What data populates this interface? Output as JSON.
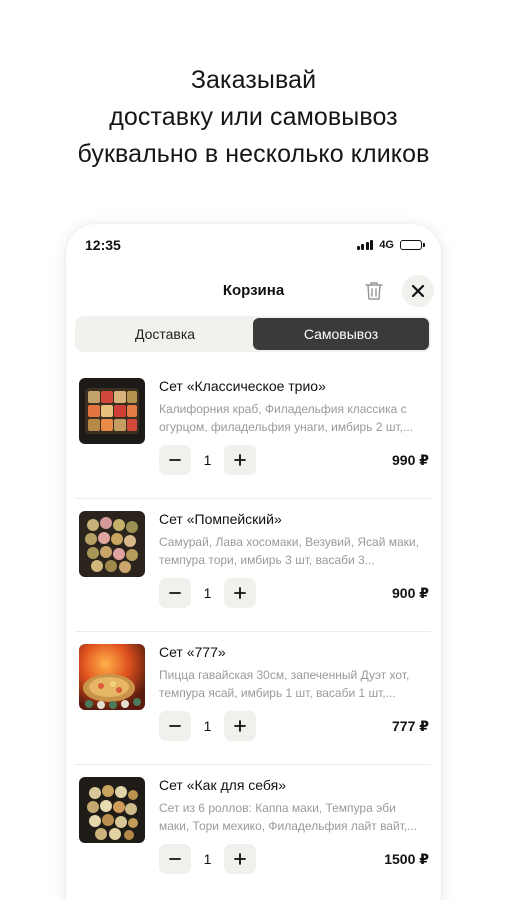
{
  "promo": {
    "line1": "Заказывай",
    "line2": "доставку или самовывоз",
    "line3": "буквально в несколько кликов"
  },
  "status_bar": {
    "time": "12:35",
    "network": "4G"
  },
  "header": {
    "title": "Корзина"
  },
  "tabs": [
    {
      "label": "Доставка",
      "active": false
    },
    {
      "label": "Самовывоз",
      "active": true
    }
  ],
  "items": [
    {
      "name": "Сет «Классическое трио»",
      "description": "Калифорния краб, Филадельфия классика с огурцом, филадельфия унаги, имбирь 2 шт,...",
      "quantity": "1",
      "price": "990 ₽"
    },
    {
      "name": "Сет «Помпейский»",
      "description": "Самурай, Лава хосомаки, Везувий, Ясай маки, темпура тори, имбирь 3 шт, васаби 3...",
      "quantity": "1",
      "price": "900 ₽"
    },
    {
      "name": "Сет «777»",
      "description": "Пицца гавайская 30см, запеченный Дуэт хот, темпура ясай, имбирь 1 шт, васаби 1 шт,...",
      "quantity": "1",
      "price": "777 ₽"
    },
    {
      "name": "Сет «Как для себя»",
      "description": "Сет из 6 роллов: Каппа маки, Темпура эби маки, Тори мехико, Филадельфия лайт вайт,...",
      "quantity": "1",
      "price": "1500 ₽"
    }
  ],
  "icons": {
    "trash": "trash-icon",
    "close": "close-icon",
    "minus": "minus-icon",
    "plus": "plus-icon"
  }
}
